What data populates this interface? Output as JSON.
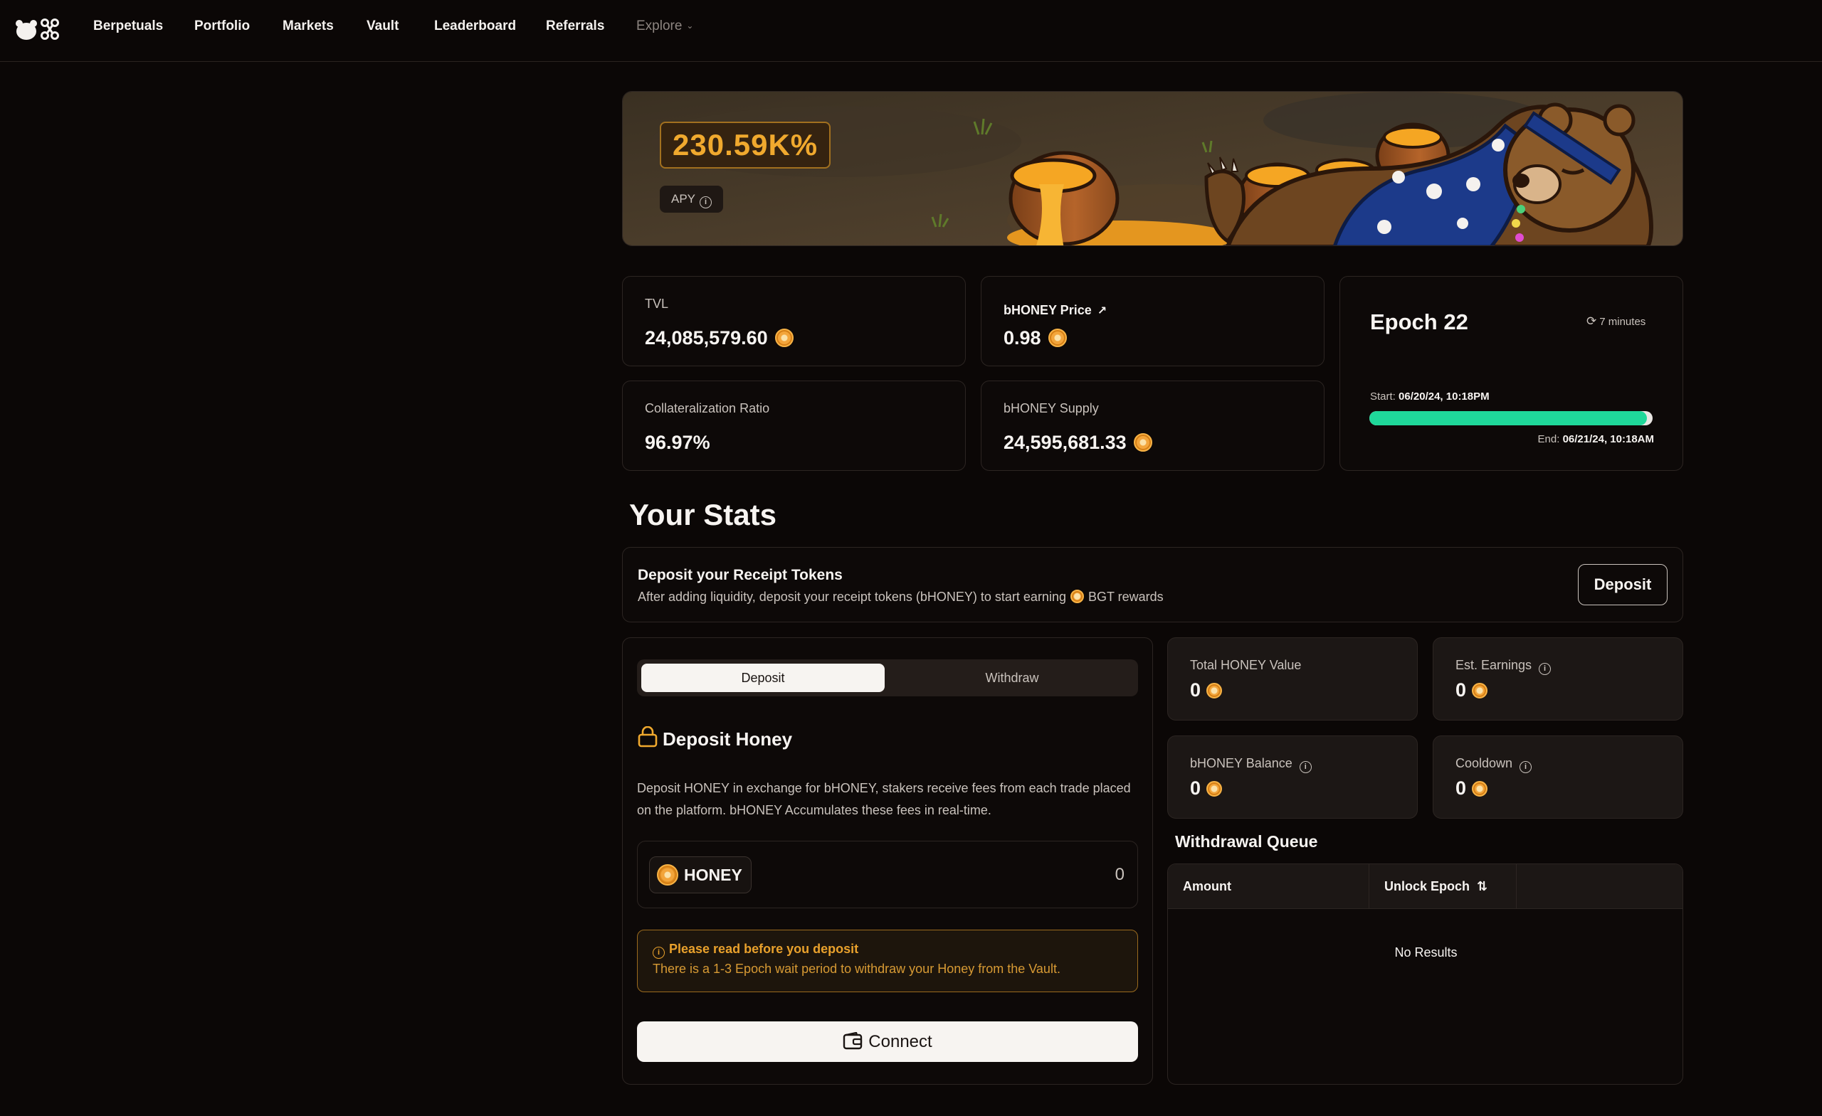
{
  "nav": {
    "items": [
      "Berpetuals",
      "Portfolio",
      "Markets",
      "Vault",
      "Leaderboard",
      "Referrals"
    ],
    "explore_label": "Explore"
  },
  "banner": {
    "apy_value": "230.59K%",
    "apy_label": "APY"
  },
  "stats": {
    "tvl": {
      "label": "TVL",
      "value": "24,085,579.60"
    },
    "price": {
      "label": "bHONEY Price",
      "value": "0.98"
    },
    "collat": {
      "label": "Collateralization Ratio",
      "value": "96.97%"
    },
    "supply": {
      "label": "bHONEY Supply",
      "value": "24,595,681.33"
    }
  },
  "epoch": {
    "title": "Epoch 22",
    "countdown": "7 minutes",
    "start_label": "Start:",
    "start_value": "06/20/24, 10:18PM",
    "end_label": "End:",
    "end_value": "06/21/24, 10:18AM",
    "progress_percent": 98
  },
  "your_stats": {
    "title": "Your Stats",
    "receipt": {
      "title": "Deposit your Receipt Tokens",
      "desc_before": "After adding liquidity, deposit your receipt tokens (bHONEY) to start earning",
      "desc_after": "BGT rewards",
      "button": "Deposit"
    }
  },
  "deposit_panel": {
    "tabs": [
      "Deposit",
      "Withdraw"
    ],
    "heading": "Deposit Honey",
    "description_line1": "Deposit HONEY in exchange for bHONEY, stakers receive fees from each trade placed",
    "description_line2": "on the platform. bHONEY Accumulates these fees in real-time.",
    "token": "HONEY",
    "amount": "0",
    "warning_title": "Please read before you deposit",
    "warning_text": "There is a 1-3 Epoch wait period to withdraw your Honey from the Vault.",
    "connect_label": "Connect"
  },
  "user_stats": {
    "total": {
      "label": "Total HONEY Value",
      "value": "0"
    },
    "earnings": {
      "label": "Est. Earnings",
      "value": "0"
    },
    "balance": {
      "label": "bHONEY Balance",
      "value": "0"
    },
    "cooldown": {
      "label": "Cooldown",
      "value": "0"
    }
  },
  "queue": {
    "title": "Withdrawal Queue",
    "columns": [
      "Amount",
      "Unlock Epoch"
    ],
    "empty": "No Results"
  },
  "colors": {
    "accent": "#f0a92e",
    "progress": "#1fd89a",
    "background": "#0b0706"
  }
}
